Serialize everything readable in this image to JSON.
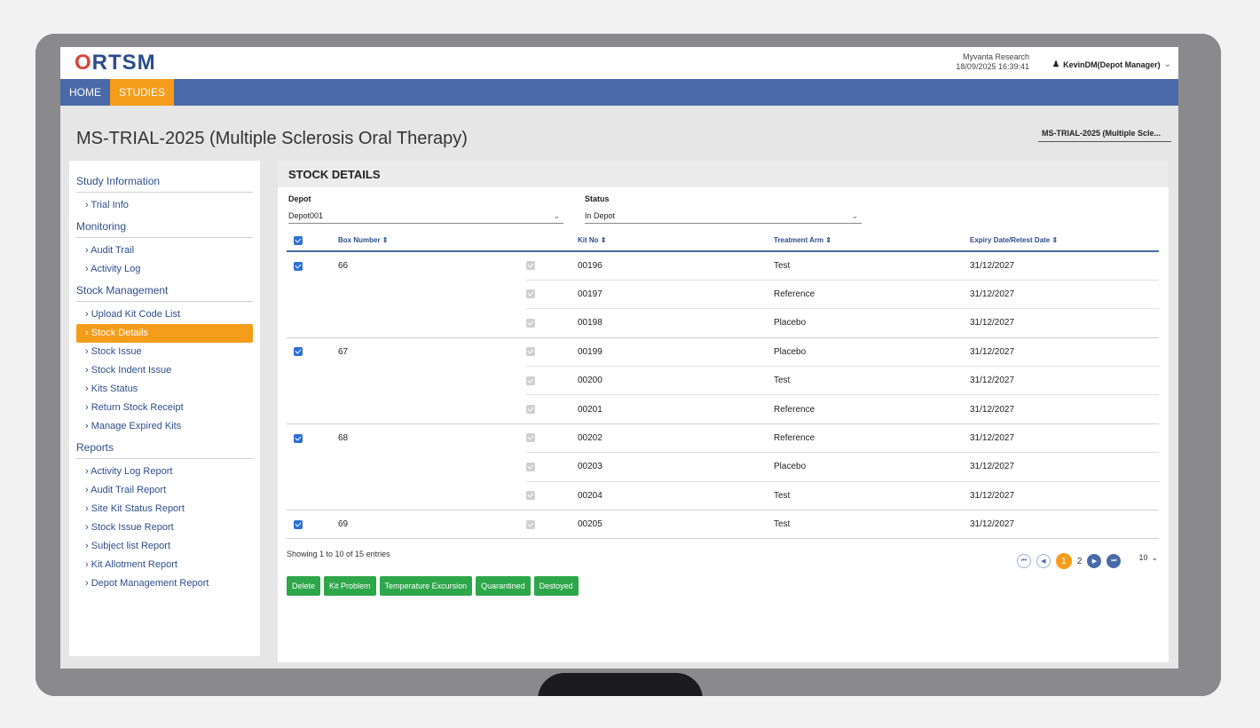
{
  "header": {
    "logo": "ORTSM",
    "org_name": "Myvanta Research",
    "datetime": "18/09/2025 16:39:41",
    "user": "KevinDM(Depot Manager)"
  },
  "nav": {
    "items": [
      {
        "label": "HOME"
      },
      {
        "label": "STUDIES"
      }
    ]
  },
  "page": {
    "title": "MS-TRIAL-2025 (Multiple Sclerosis Oral Therapy)",
    "study_selector": "MS-TRIAL-2025 (Multiple Scle..."
  },
  "sidebar": {
    "sections": [
      {
        "title": "Study Information",
        "links": [
          "Trial Info"
        ]
      },
      {
        "title": "Monitoring",
        "links": [
          "Audit Trail",
          "Activity Log"
        ]
      },
      {
        "title": "Stock Management",
        "links": [
          "Upload Kit Code List",
          "Stock Details",
          "Stock Issue",
          "Stock Indent Issue",
          "Kits Status",
          "Return Stock Receipt",
          "Manage Expired Kits"
        ]
      },
      {
        "title": "Reports",
        "links": [
          "Activity Log Report",
          "Audit Trail Report",
          "Site Kit Status Report",
          "Stock Issue Report",
          "Subject list Report",
          "Kit Allotment Report",
          "Depot Management Report"
        ]
      }
    ],
    "active_link": "Stock Details"
  },
  "content": {
    "title": "STOCK DETAILS",
    "filters": {
      "depot_label": "Depot",
      "depot_value": "Depot001",
      "status_label": "Status",
      "status_value": "In Depot"
    },
    "table": {
      "headers": {
        "box": "Box Number ⇕",
        "kit": "Kit No ⇕",
        "arm": "Treatment Arm ⇕",
        "expiry": "Expiry Date/Retest Date ⇕"
      },
      "rows": [
        {
          "box": "66",
          "kit": "00196",
          "arm": "Test",
          "expiry": "31/12/2027"
        },
        {
          "box": "",
          "kit": "00197",
          "arm": "Reference",
          "expiry": "31/12/2027"
        },
        {
          "box": "",
          "kit": "00198",
          "arm": "Placebo",
          "expiry": "31/12/2027"
        },
        {
          "box": "67",
          "kit": "00199",
          "arm": "Placebo",
          "expiry": "31/12/2027"
        },
        {
          "box": "",
          "kit": "00200",
          "arm": "Test",
          "expiry": "31/12/2027"
        },
        {
          "box": "",
          "kit": "00201",
          "arm": "Reference",
          "expiry": "31/12/2027"
        },
        {
          "box": "68",
          "kit": "00202",
          "arm": "Reference",
          "expiry": "31/12/2027"
        },
        {
          "box": "",
          "kit": "00203",
          "arm": "Placebo",
          "expiry": "31/12/2027"
        },
        {
          "box": "",
          "kit": "00204",
          "arm": "Test",
          "expiry": "31/12/2027"
        },
        {
          "box": "69",
          "kit": "00205",
          "arm": "Test",
          "expiry": "31/12/2027"
        }
      ]
    },
    "showing": "Showing 1 to 10 of 15 entries",
    "pagination": {
      "pages": [
        "1",
        "2"
      ],
      "current": "1",
      "page_size": "10"
    },
    "actions": [
      "Delete",
      "Kit Problem",
      "Temperature Excursion",
      "Quarantined",
      "Destoyed"
    ]
  },
  "colors": {
    "brand_blue": "#4a6aa7",
    "accent_orange": "#f59c1a",
    "action_green": "#2ea64a"
  }
}
